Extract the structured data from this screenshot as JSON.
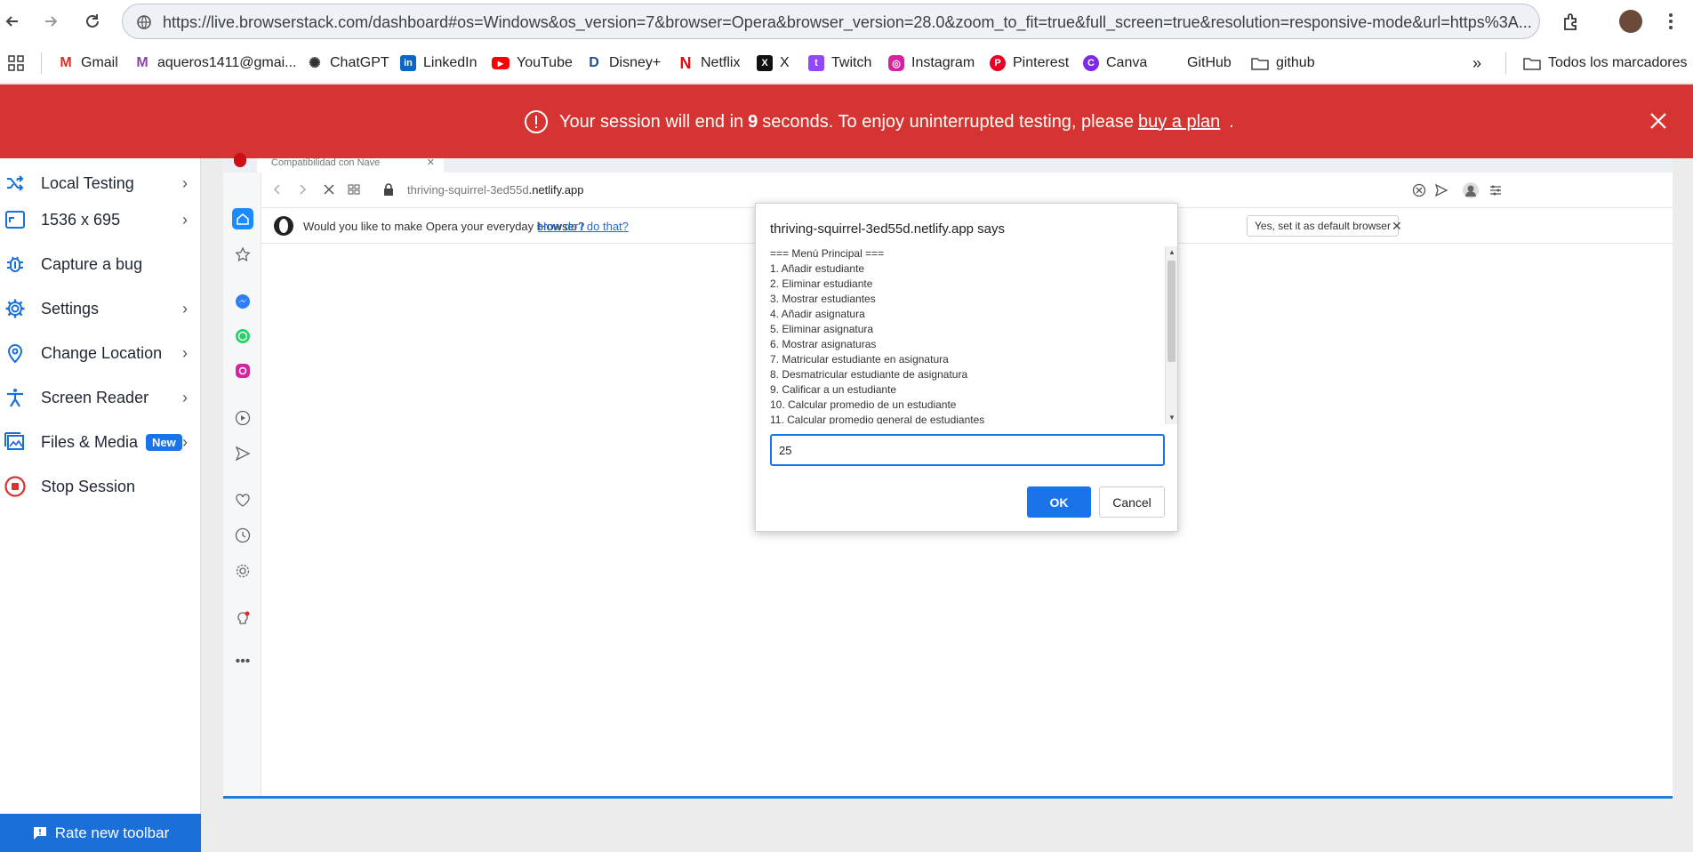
{
  "browser": {
    "url": "https://live.browserstack.com/dashboard#os=Windows&os_version=7&browser=Opera&browser_version=28.0&zoom_to_fit=true&full_screen=true&resolution=responsive-mode&url=https%3A..."
  },
  "bookmarks": {
    "items": [
      {
        "label": "Gmail"
      },
      {
        "label": "aqueros1411@gmai..."
      },
      {
        "label": "ChatGPT"
      },
      {
        "label": "LinkedIn"
      },
      {
        "label": "YouTube"
      },
      {
        "label": "Disney+"
      },
      {
        "label": "Netflix"
      },
      {
        "label": "X"
      },
      {
        "label": "Twitch"
      },
      {
        "label": "Instagram"
      },
      {
        "label": "Pinterest"
      },
      {
        "label": "Canva"
      },
      {
        "label": "GitHub"
      },
      {
        "label": "github"
      }
    ],
    "more": "»",
    "all_bookmarks": "Todos los marcadores"
  },
  "banner": {
    "prefix": "Your session will end in",
    "seconds": "9",
    "middle": "seconds. To enjoy uninterrupted testing, please",
    "link": "buy a plan",
    "suffix": ".",
    "color": "#d63433"
  },
  "toolbar": {
    "items": [
      {
        "label": "Local Testing",
        "icon": "local-testing-icon"
      },
      {
        "label": "1536 x 695",
        "icon": "resolution-icon"
      },
      {
        "label": "Capture a bug",
        "icon": "bug-icon"
      },
      {
        "label": "Settings",
        "icon": "gear-icon"
      },
      {
        "label": "Change Location",
        "icon": "location-pin-icon"
      },
      {
        "label": "Screen Reader",
        "icon": "accessibility-icon"
      },
      {
        "label": "Files & Media",
        "icon": "image-icon",
        "badge": "New"
      },
      {
        "label": "Stop Session",
        "icon": "stop-icon"
      }
    ],
    "rate_label": "Rate new toolbar",
    "accent": "#1a6fd8"
  },
  "remote": {
    "tab_title": "Compatibilidad con Nave",
    "address": {
      "domain": "thriving-squirrel-3ed55d",
      "suffix": ".netlify.app"
    },
    "infobar": {
      "question": "Would you like to make Opera your everyday browser?",
      "link": "How do I do that?",
      "button": "Yes, set it as default browser"
    }
  },
  "dialog": {
    "title": "thriving-squirrel-3ed55d.netlify.app says",
    "lines": [
      "=== Menú Principal ===",
      "1. Añadir estudiante",
      "2. Eliminar estudiante",
      "3. Mostrar estudiantes",
      "4. Añadir asignatura",
      "5. Eliminar asignatura",
      "6. Mostrar asignaturas",
      "7. Matricular estudiante en asignatura",
      "8. Desmatricular estudiante de asignatura",
      "9. Calificar a un estudiante",
      "10. Calcular promedio de un estudiante",
      "11. Calcular promedio general de estudiantes"
    ],
    "input_value": "25",
    "ok_label": "OK",
    "cancel_label": "Cancel",
    "accent": "#1a73e8"
  }
}
